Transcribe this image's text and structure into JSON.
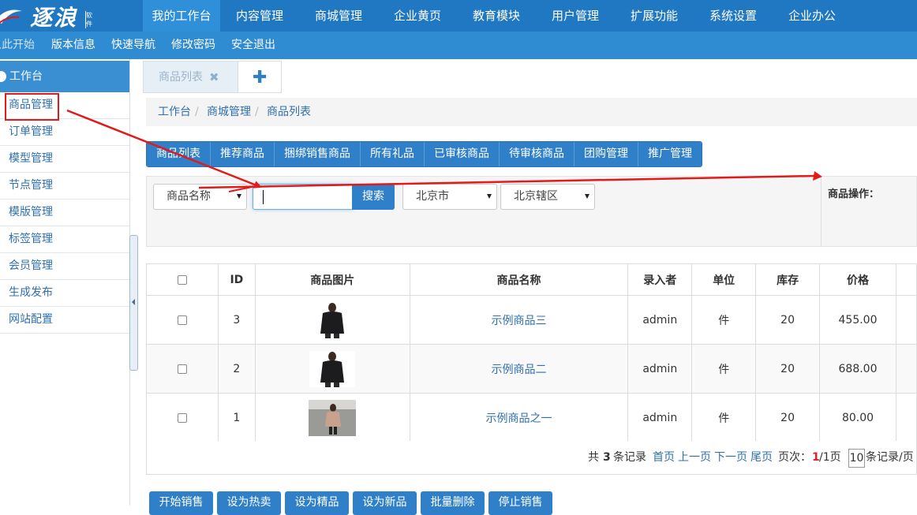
{
  "logo": {
    "text": "逐浪",
    "badge": "软件"
  },
  "nav": [
    {
      "label": "我的工作台",
      "active": true
    },
    {
      "label": "内容管理"
    },
    {
      "label": "商城管理"
    },
    {
      "label": "企业黄页"
    },
    {
      "label": "教育模块"
    },
    {
      "label": "用户管理"
    },
    {
      "label": "扩展功能"
    },
    {
      "label": "系统设置"
    },
    {
      "label": "企业办公"
    }
  ],
  "subnav": [
    "从此开始",
    "版本信息",
    "快速导航",
    "修改密码",
    "安全退出"
  ],
  "sidebar": {
    "title": "工作台",
    "items": [
      "商品管理",
      "订单管理",
      "模型管理",
      "节点管理",
      "模版管理",
      "标签管理",
      "会员管理",
      "生成发布",
      "网站配置"
    ]
  },
  "tabs": {
    "active_label": "商品列表",
    "close": "✖",
    "add": "✚"
  },
  "breadcrumb": [
    "工作台",
    "商城管理",
    "商品列表"
  ],
  "button_group": [
    "商品列表",
    "推荐商品",
    "捆绑销售商品",
    "所有礼品",
    "已审核商品",
    "待审核商品",
    "团购管理",
    "推广管理"
  ],
  "filter": {
    "field_select": "商品名称",
    "search_value": "",
    "search_button": "搜索",
    "province": "北京市",
    "district": "北京辖区",
    "ops_label": "商品操作："
  },
  "table": {
    "headers": [
      "",
      "ID",
      "商品图片",
      "商品名称",
      "录入者",
      "单位",
      "库存",
      "价格"
    ],
    "rows": [
      {
        "id": "3",
        "name": "示例商品三",
        "author": "admin",
        "unit": "件",
        "stock": "20",
        "price": "455.00",
        "image": "jacket-photo-icon"
      },
      {
        "id": "2",
        "name": "示例商品二",
        "author": "admin",
        "unit": "件",
        "stock": "20",
        "price": "688.00",
        "image": "jacket-photo-icon"
      },
      {
        "id": "1",
        "name": "示例商品之一",
        "author": "admin",
        "unit": "件",
        "stock": "20",
        "price": "80.00",
        "image": "coat-photo-icon"
      }
    ]
  },
  "pager": {
    "total_prefix": "共",
    "total": "3",
    "total_suffix": "条记录",
    "first": "首页",
    "prev": "上一页",
    "next": "下一页",
    "last": "尾页",
    "page_prefix": "页次：",
    "current": "1",
    "pages": "/1页",
    "page_size": "10",
    "size_suffix": "条记录/页"
  },
  "bottom_buttons": [
    "开始销售",
    "设为热卖",
    "设为精品",
    "设为新品",
    "批量删除",
    "停止销售"
  ],
  "colors": {
    "primary": "#1f78c1",
    "sub": "#2f8bd2",
    "annotation": "#e21a1a"
  }
}
